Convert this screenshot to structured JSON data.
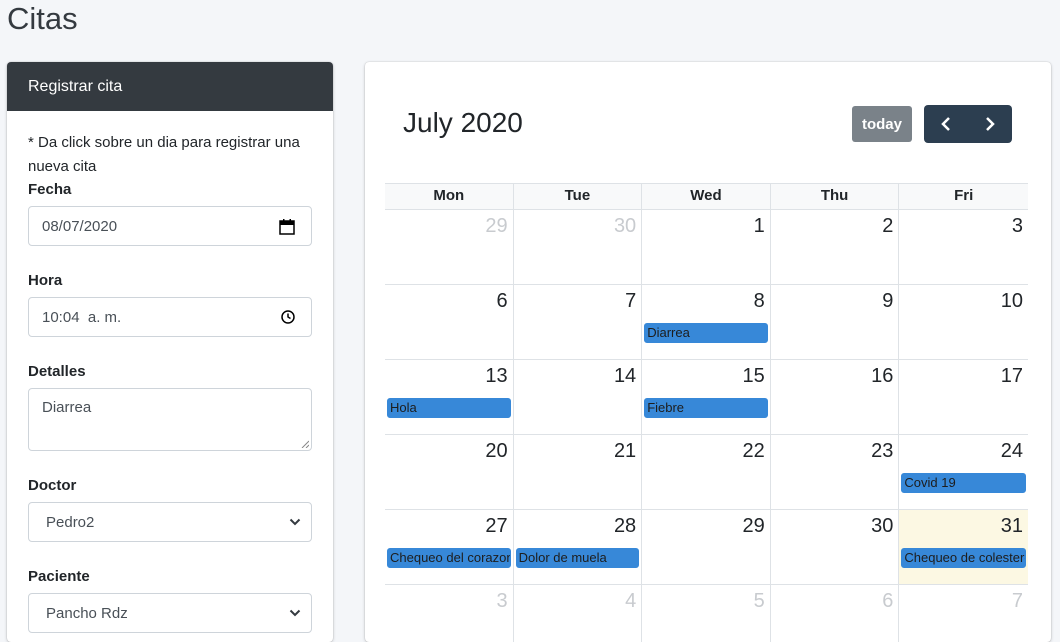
{
  "page": {
    "title": "Citas"
  },
  "form": {
    "header": "Registrar cita",
    "hint": "* Da click sobre un dia para registrar una nueva cita",
    "fecha": {
      "label": "Fecha",
      "value": "08/07/2020"
    },
    "hora": {
      "label": "Hora",
      "value": "10:04  a. m."
    },
    "detalles": {
      "label": "Detalles",
      "value": "Diarrea"
    },
    "doctor": {
      "label": "Doctor",
      "value": "Pedro2"
    },
    "paciente": {
      "label": "Paciente",
      "value": "Pancho Rdz"
    }
  },
  "calendar": {
    "title": "July 2020",
    "today_label": "today",
    "weekdays": [
      "Mon",
      "Tue",
      "Wed",
      "Thu",
      "Fri"
    ],
    "weeks": [
      [
        {
          "day": "29",
          "other": true
        },
        {
          "day": "30",
          "other": true
        },
        {
          "day": "1"
        },
        {
          "day": "2"
        },
        {
          "day": "3"
        }
      ],
      [
        {
          "day": "6"
        },
        {
          "day": "7"
        },
        {
          "day": "8",
          "event": "Diarrea"
        },
        {
          "day": "9"
        },
        {
          "day": "10"
        }
      ],
      [
        {
          "day": "13",
          "event": "Hola"
        },
        {
          "day": "14"
        },
        {
          "day": "15",
          "event": "Fiebre"
        },
        {
          "day": "16"
        },
        {
          "day": "17"
        }
      ],
      [
        {
          "day": "20"
        },
        {
          "day": "21"
        },
        {
          "day": "22"
        },
        {
          "day": "23"
        },
        {
          "day": "24",
          "event": "Covid 19"
        }
      ],
      [
        {
          "day": "27",
          "event": "Chequeo del corazon"
        },
        {
          "day": "28",
          "event": "Dolor de muela"
        },
        {
          "day": "29"
        },
        {
          "day": "30"
        },
        {
          "day": "31",
          "event": "Chequeo de colesterol",
          "today": true
        }
      ],
      [
        {
          "day": "3",
          "other": true
        },
        {
          "day": "4",
          "other": true
        },
        {
          "day": "5",
          "other": true
        },
        {
          "day": "6",
          "other": true
        },
        {
          "day": "7",
          "other": true
        }
      ]
    ],
    "colors": {
      "event": "#3788d8",
      "today_bg": "#fcf8e3",
      "nav": "#2c3e50"
    }
  }
}
